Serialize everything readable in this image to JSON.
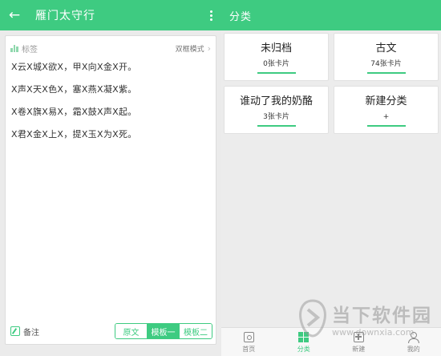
{
  "left": {
    "title": "雁门太守行",
    "back_icon": "arrow-left-icon",
    "more_icon": "more-vertical-icon",
    "tag_label": "标签",
    "mode_label": "双框模式",
    "lines": [
      "X云X城X欲X，甲X向X金X开。",
      "X声X天X色X，塞X燕X凝X紫。",
      "X卷X旗X易X，霜X鼓X声X起。",
      "X君X金X上X，提X玉X为X死。"
    ],
    "note_label": "备注",
    "segments": [
      "原文",
      "模板一",
      "模板二"
    ],
    "active_segment": "模板一"
  },
  "right": {
    "title": "分类",
    "categories": [
      {
        "name": "未归档",
        "count": "0张卡片"
      },
      {
        "name": "古文",
        "count": "74张卡片"
      },
      {
        "name": "谁动了我的奶酪",
        "count": "3张卡片"
      },
      {
        "name": "新建分类",
        "count": "+"
      }
    ],
    "tabs": [
      {
        "label": "首页",
        "icon": "home-icon"
      },
      {
        "label": "分类",
        "icon": "category-icon"
      },
      {
        "label": "新建",
        "icon": "add-icon"
      },
      {
        "label": "我的",
        "icon": "profile-icon"
      }
    ],
    "active_tab": "分类"
  },
  "watermark": {
    "text": "当下软件园",
    "url": "www.downxia.com"
  },
  "colors": {
    "accent": "#3ecb81",
    "background": "#ebebeb"
  }
}
